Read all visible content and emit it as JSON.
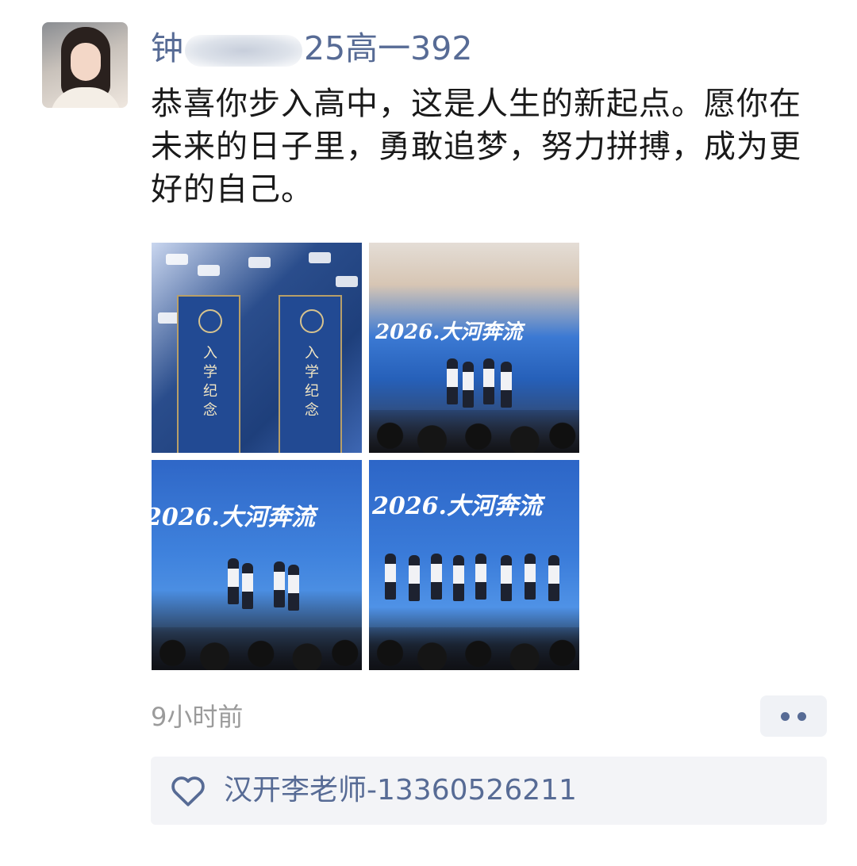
{
  "post": {
    "username_prefix": "钟",
    "username_suffix": "25高一392",
    "text": "恭喜你步入高中，这是人生的新起点。愿你在未来的日子里，勇敢追梦，努力拼搏，成为更好的自己。",
    "timestamp": "9小时前"
  },
  "photos": {
    "box_label": "入学纪念",
    "screen_title": "2026.大河奔流"
  },
  "likes": {
    "names": "汉开李老师-13360526211"
  },
  "icons": {
    "avatar": "profile-photo",
    "more": "more-dots-icon",
    "like": "heart-outline-icon"
  },
  "colors": {
    "link": "#576b95",
    "text": "#1a1a1a",
    "muted": "#9b9b9b",
    "panel": "#f3f4f7"
  }
}
